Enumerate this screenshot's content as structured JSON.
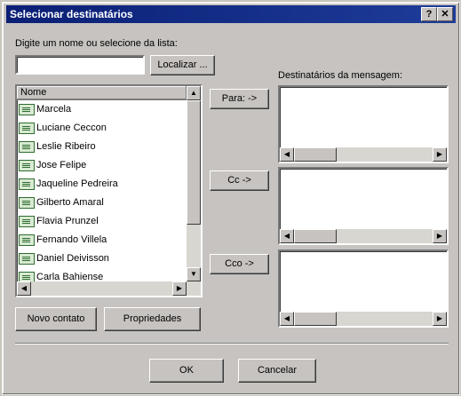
{
  "window": {
    "title": "Selecionar destinatários",
    "help_label": "?",
    "close_label": "✕"
  },
  "search": {
    "prompt": "Digite um nome ou selecione da lista:",
    "prompt_mnemonic": "i",
    "value": "",
    "find_button": "Localizar ...",
    "find_mnemonic": "L"
  },
  "list": {
    "column_header": "Nome",
    "items": [
      "Marcela",
      "Luciane Ceccon",
      "Leslie Ribeiro",
      "Jose Felipe",
      "Jaqueline Pedreira",
      "Gilberto Amaral",
      "Flavia Prunzel",
      "Fernando Villela",
      "Daniel Deivisson",
      "Carla Bahiense"
    ]
  },
  "recipients": {
    "label": "Destinatários da mensagem:",
    "to_button": "Para: ->",
    "cc_button": "Cc ->",
    "bcc_button": "Cco ->"
  },
  "actions": {
    "new_contact": "Novo contato",
    "properties": "Propriedades",
    "ok": "OK",
    "cancel": "Cancelar"
  },
  "icons": {
    "contact": "contact-card-icon",
    "scroll_up": "arrow-up-icon",
    "scroll_down": "arrow-down-icon",
    "scroll_left": "arrow-left-icon",
    "scroll_right": "arrow-right-icon"
  },
  "colors": {
    "titlebar": "#0a1f75",
    "dialog_bg": "#c6c3c0"
  }
}
